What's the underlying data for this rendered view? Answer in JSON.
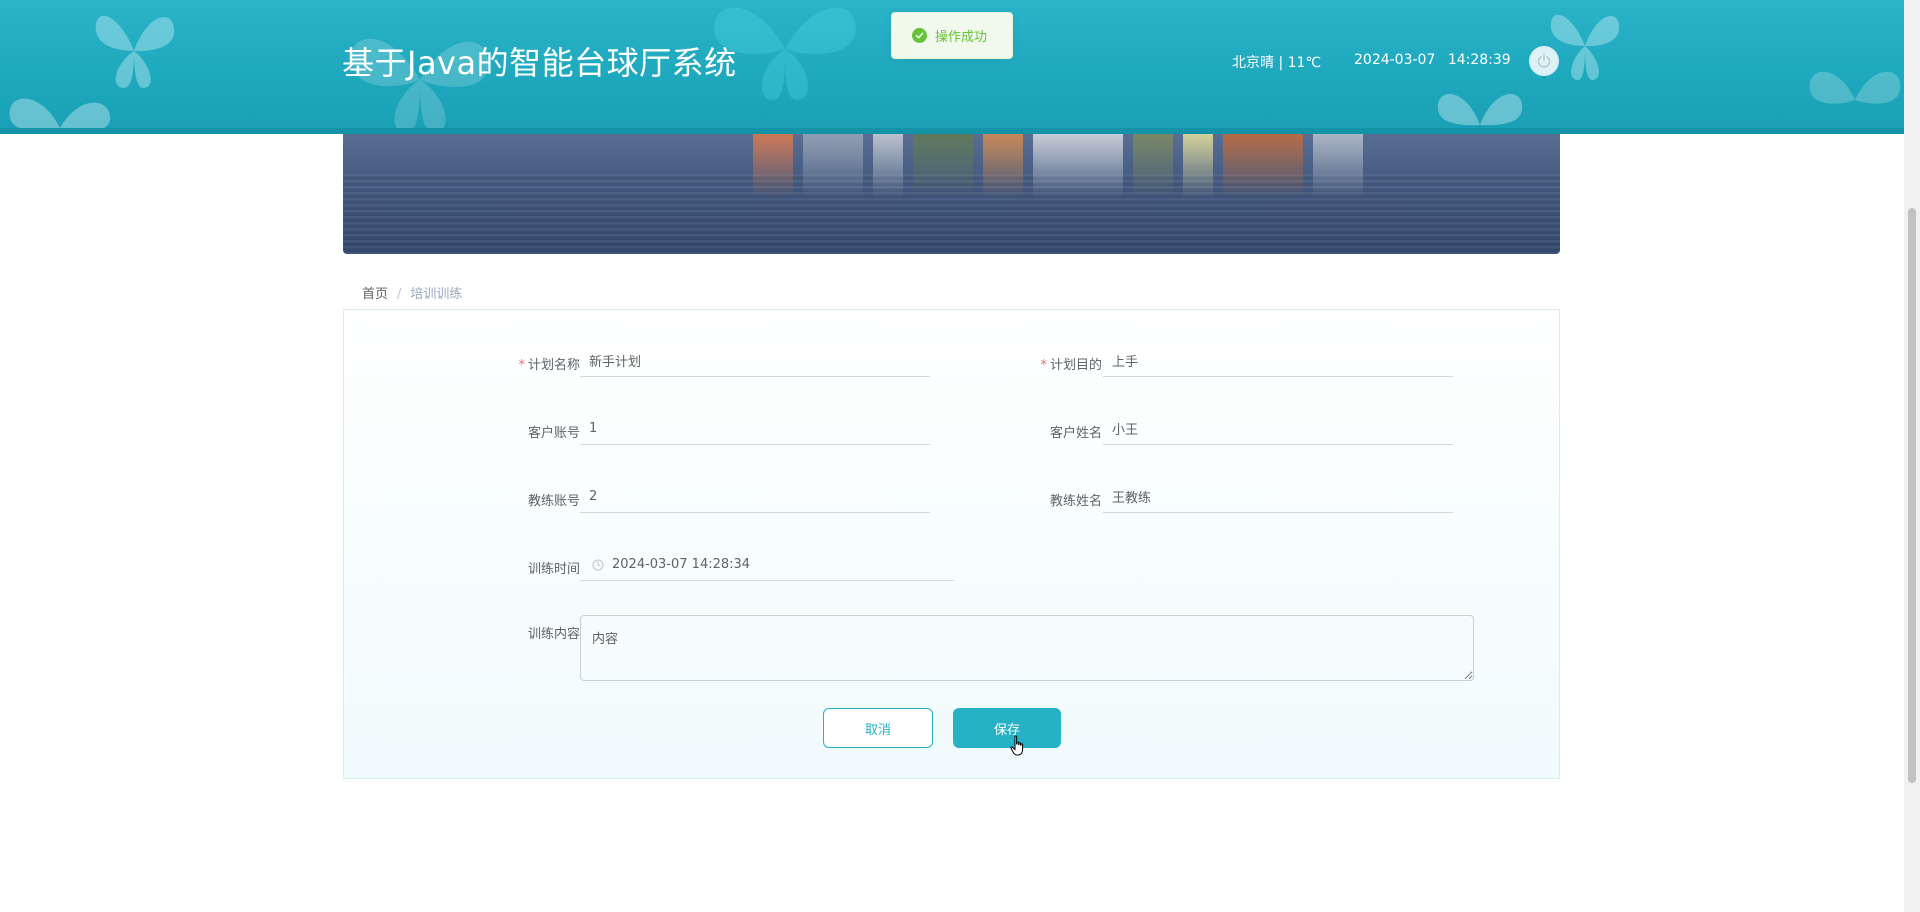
{
  "header": {
    "title": "基于Java的智能台球厅系统",
    "weather": "北京晴 | 11℃",
    "date": "2024-03-07",
    "time": "14:28:39",
    "colors": {
      "bar": "#1fa9be",
      "accent": "#26b1c6"
    }
  },
  "toast": {
    "message": "操作成功",
    "type": "success",
    "color": "#67c23a"
  },
  "breadcrumb": {
    "home": "首页",
    "separator": "/",
    "current": "培训训练"
  },
  "form": {
    "plan_name": {
      "label": "计划名称",
      "value": "新手计划",
      "required": true
    },
    "plan_goal": {
      "label": "计划目的",
      "value": "上手",
      "required": true
    },
    "customer_account": {
      "label": "客户账号",
      "value": "1"
    },
    "customer_name": {
      "label": "客户姓名",
      "value": "小王"
    },
    "coach_account": {
      "label": "教练账号",
      "value": "2"
    },
    "coach_name": {
      "label": "教练姓名",
      "value": "王教练"
    },
    "training_time": {
      "label": "训练时间",
      "value": "2024-03-07 14:28:34"
    },
    "training_content": {
      "label": "训练内容",
      "value": "内容"
    },
    "required_mark": "*"
  },
  "actions": {
    "cancel_label": "取消",
    "save_label": "保存"
  },
  "icons": {
    "toast": "check-circle-icon",
    "power": "power-icon",
    "clock": "clock-icon",
    "cursor": "hand-pointer-icon",
    "decoration": "butterfly-icon"
  }
}
